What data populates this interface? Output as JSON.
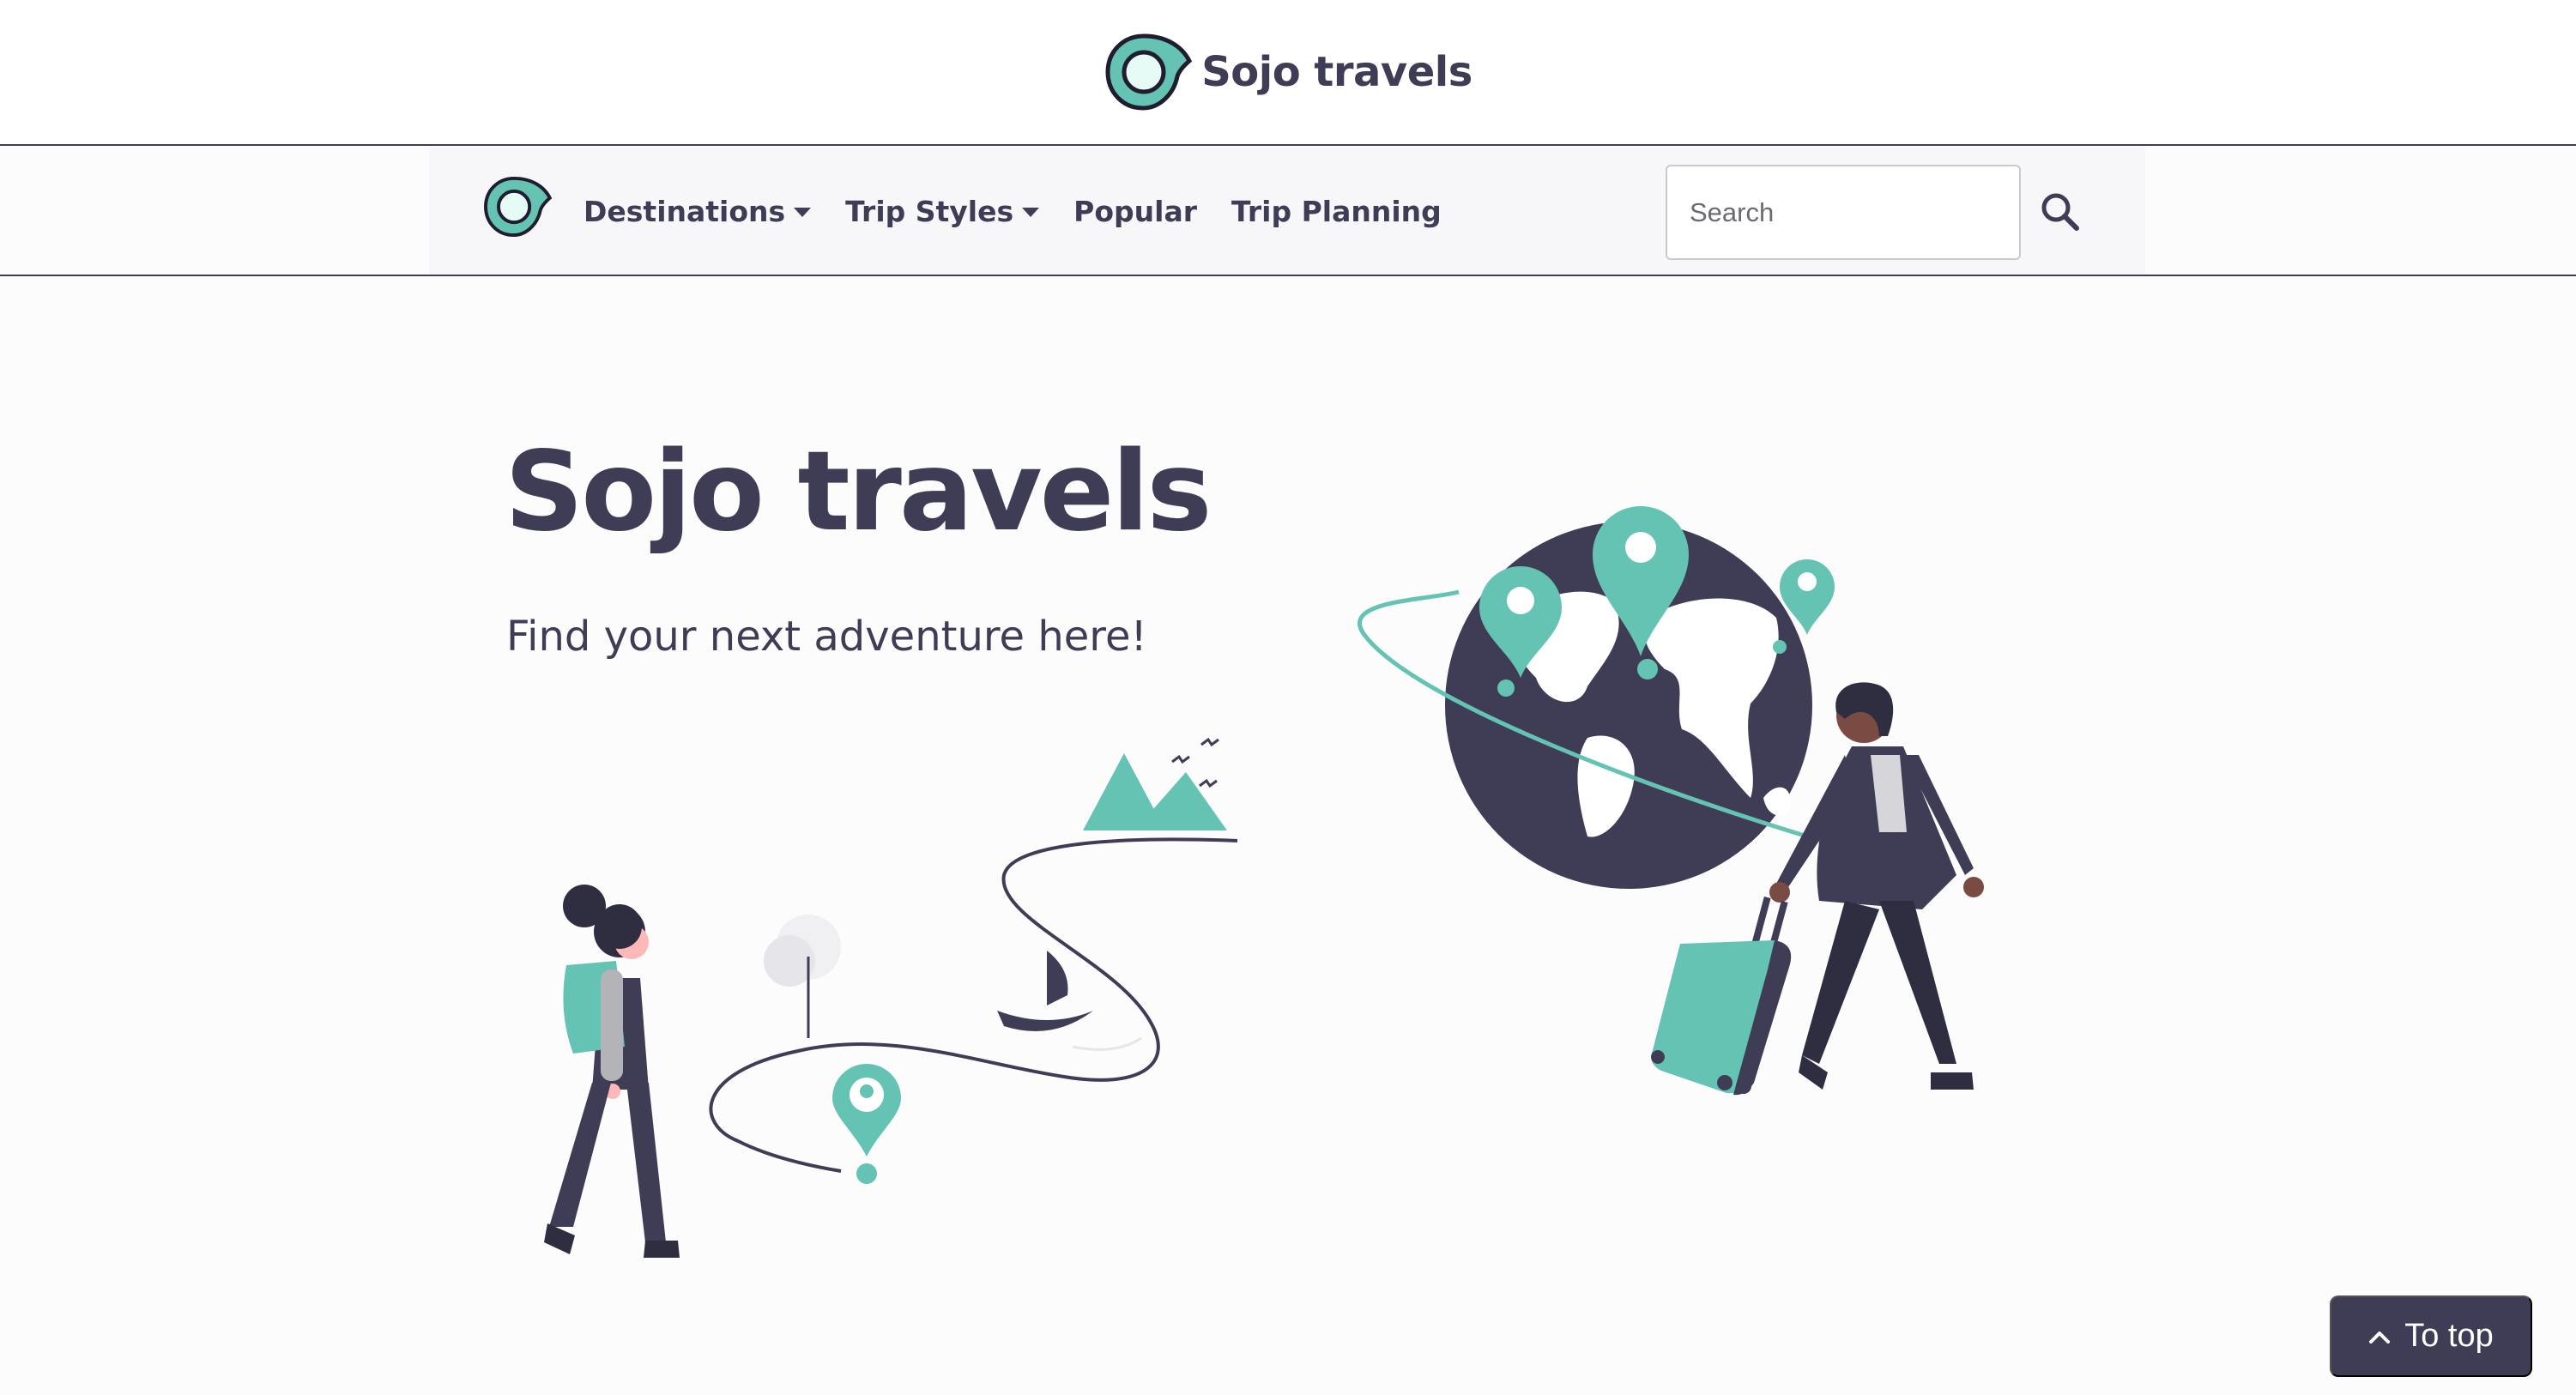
{
  "brand": {
    "name": "Sojo travels",
    "logo_icon": "map-pin-eye-icon"
  },
  "nav": {
    "items": [
      {
        "label": "Destinations",
        "has_dropdown": true
      },
      {
        "label": "Trip Styles",
        "has_dropdown": true
      },
      {
        "label": "Popular",
        "has_dropdown": false
      },
      {
        "label": "Trip Planning",
        "has_dropdown": false
      }
    ],
    "search": {
      "placeholder": "Search",
      "value": "",
      "icon": "search-icon"
    }
  },
  "hero": {
    "title": "Sojo travels",
    "subtitle": "Find your next adventure here!",
    "illustration": "travelers-globe-illustration"
  },
  "to_top": {
    "label": "To top",
    "icon": "chevron-up-icon"
  },
  "colors": {
    "primary": "#3f3d56",
    "accent": "#64c3b3",
    "background": "#fcfcfd"
  }
}
